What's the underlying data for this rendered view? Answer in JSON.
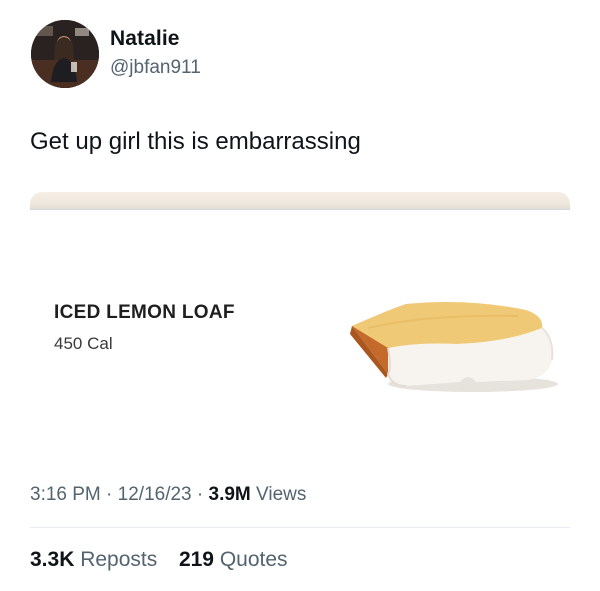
{
  "author": {
    "name": "Natalie",
    "handle": "@jbfan911"
  },
  "tweet": {
    "text": "Get up girl this is embarrassing"
  },
  "card": {
    "product_name": "ICED LEMON LOAF",
    "calories": "450 Cal"
  },
  "meta": {
    "time": "3:16 PM",
    "separator": "·",
    "date": "12/16/23",
    "views_count": "3.9M",
    "views_label": "Views"
  },
  "stats": {
    "reposts_count": "3.3K",
    "reposts_label": "Reposts",
    "quotes_count": "219",
    "quotes_label": "Quotes"
  }
}
